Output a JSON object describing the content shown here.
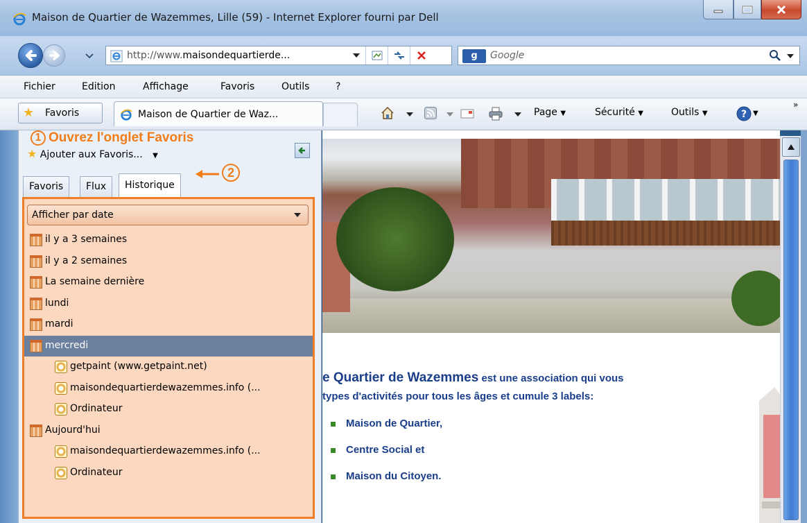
{
  "window": {
    "title": "Maison de Quartier de Wazemmes, Lille (59) - Internet Explorer fourni par Dell"
  },
  "address": {
    "url_prefix": "http://www.",
    "url_domain": "maisondequartierde...",
    "search_placeholder": "Google",
    "search_logo": "g"
  },
  "menu": {
    "items": [
      "Fichier",
      "Edition",
      "Affichage",
      "Favoris",
      "Outils",
      "?"
    ]
  },
  "commandbar": {
    "favorites_button": "Favoris",
    "tab_title": "Maison de Quartier de Waz...",
    "page": "Page",
    "security": "Sécurité",
    "tools": "Outils",
    "chevron": "»"
  },
  "favorites_pane": {
    "add_to_favorites": "Ajouter aux Favoris...",
    "tabs": [
      "Favoris",
      "Flux",
      "Historique"
    ],
    "view_mode": "Afficher par date",
    "history": [
      {
        "label": "il y a 3 semaines",
        "type": "date",
        "level": 0,
        "selected": false
      },
      {
        "label": "il y a 2 semaines",
        "type": "date",
        "level": 0,
        "selected": false
      },
      {
        "label": "La semaine dernière",
        "type": "date",
        "level": 0,
        "selected": false
      },
      {
        "label": "lundi",
        "type": "date",
        "level": 0,
        "selected": false
      },
      {
        "label": "mardi",
        "type": "date",
        "level": 0,
        "selected": false
      },
      {
        "label": "mercredi",
        "type": "date",
        "level": 0,
        "selected": true
      },
      {
        "label": "getpaint (www.getpaint.net)",
        "type": "site",
        "level": 1,
        "selected": false
      },
      {
        "label": "maisondequartierdewazemmes.info (...",
        "type": "site",
        "level": 1,
        "selected": false
      },
      {
        "label": "Ordinateur",
        "type": "site",
        "level": 1,
        "selected": false
      },
      {
        "label": "Aujourd'hui",
        "type": "date",
        "level": 0,
        "selected": false
      },
      {
        "label": "maisondequartierdewazemmes.info (...",
        "type": "site",
        "level": 1,
        "selected": false
      },
      {
        "label": "Ordinateur",
        "type": "site",
        "level": 1,
        "selected": false
      }
    ]
  },
  "annotations": {
    "step1_number": "1",
    "step1_text": "Ouvrez l'onglet Favoris",
    "step2_number": "2",
    "color": "#f07d1a"
  },
  "page": {
    "intro_line1_bold": "e Quartier de Wazemmes",
    "intro_line1_rest": " est une association qui vous",
    "intro_line2": "types d'activités pour tous les âges et cumule 3 labels:",
    "labels": [
      "Maison de Quartier,",
      "Centre Social et",
      "Maison du Citoyen."
    ]
  }
}
